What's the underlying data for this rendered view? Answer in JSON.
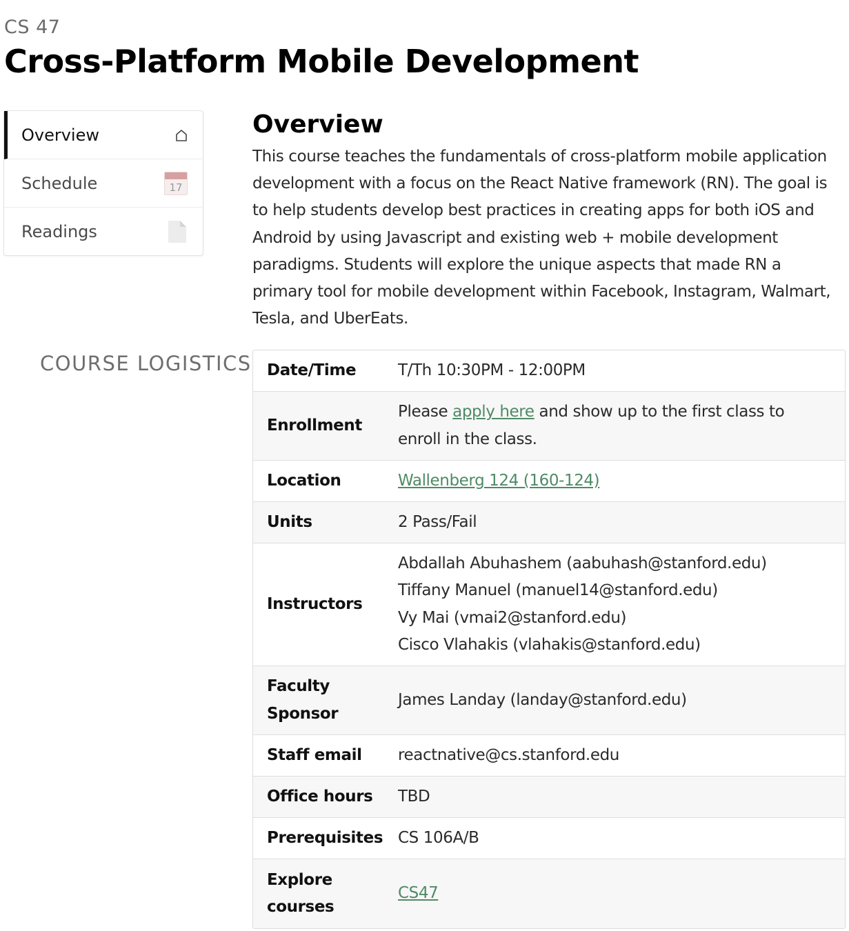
{
  "header": {
    "course_code": "CS 47",
    "course_title": "Cross-Platform Mobile Development"
  },
  "sidebar": {
    "items": [
      {
        "label": "Overview",
        "icon": "home-icon",
        "active": true
      },
      {
        "label": "Schedule",
        "icon": "calendar-icon",
        "icon_text": "17"
      },
      {
        "label": "Readings",
        "icon": "document-icon"
      }
    ]
  },
  "overview": {
    "heading": "Overview",
    "description": "This course teaches the fundamentals of cross-platform mobile application development with a focus on the React Native framework (RN). The goal is to help students develop best practices in creating apps for both iOS and Android by using Javascript and existing web + mobile development paradigms. Students will explore the unique aspects that made RN a primary tool for mobile development within Facebook, Instagram, Walmart, Tesla, and UberEats."
  },
  "logistics": {
    "section_label": "COURSE LOGISTICS",
    "rows": {
      "datetime": {
        "label": "Date/Time",
        "value": "T/Th 10:30PM - 12:00PM"
      },
      "enrollment": {
        "label": "Enrollment",
        "prefix": "Please ",
        "link_text": "apply here",
        "suffix": " and show up to the first class to enroll in the class."
      },
      "location": {
        "label": "Location",
        "link_text": "Wallenberg 124 (160-124)"
      },
      "units": {
        "label": "Units",
        "value": "2 Pass/Fail"
      },
      "instructors": {
        "label": "Instructors",
        "values": [
          "Abdallah Abuhashem (aabuhash@stanford.edu)",
          "Tiffany Manuel (manuel14@stanford.edu)",
          "Vy Mai (vmai2@stanford.edu)",
          "Cisco Vlahakis (vlahakis@stanford.edu)"
        ]
      },
      "faculty_sponsor": {
        "label": "Faculty Sponsor",
        "value": "James Landay (landay@stanford.edu)"
      },
      "staff_email": {
        "label": "Staff email",
        "value": "reactnative@cs.stanford.edu"
      },
      "office_hours": {
        "label": "Office hours",
        "value": "TBD"
      },
      "prerequisites": {
        "label": "Prerequisites",
        "value": "CS 106A/B"
      },
      "explore_courses": {
        "label": "Explore courses",
        "link_text": "CS47"
      }
    }
  },
  "colors": {
    "link": "#4f8a66",
    "active_nav_bar": "#111111",
    "calendar_accent": "#d7a0a0"
  }
}
